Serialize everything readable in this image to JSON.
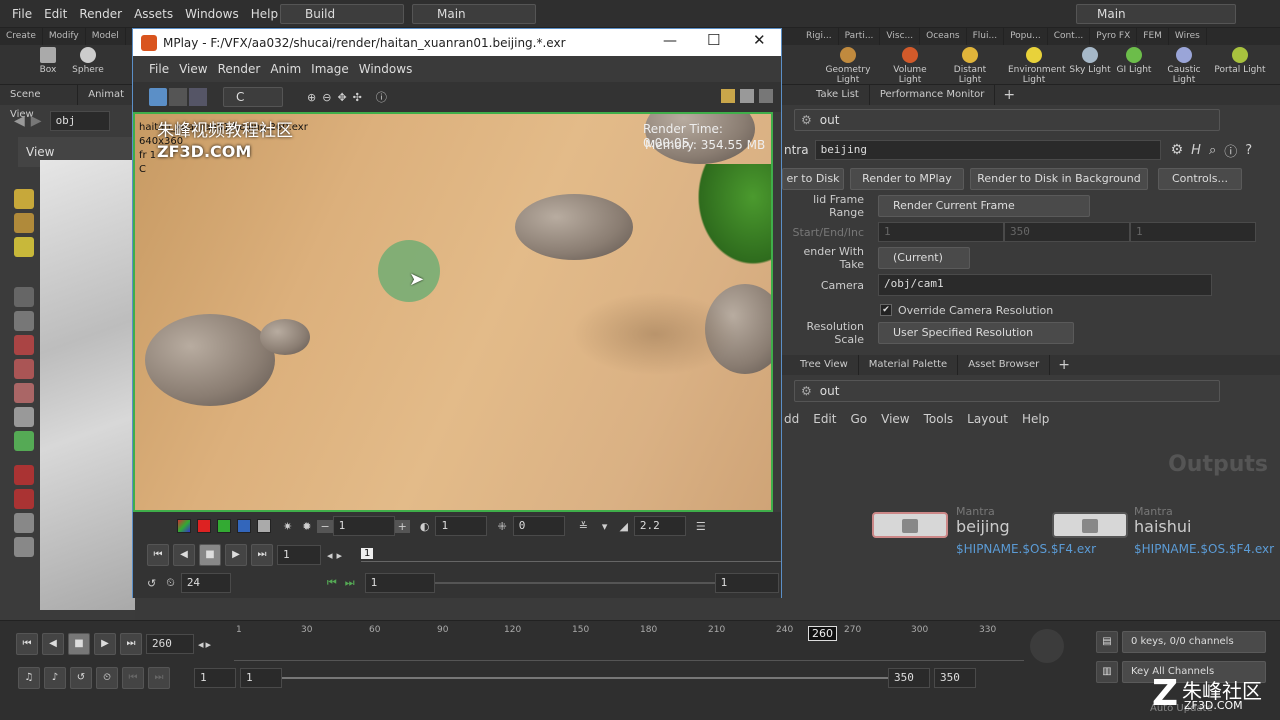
{
  "menubar": {
    "items": [
      "File",
      "Edit",
      "Render",
      "Assets",
      "Windows",
      "Help"
    ],
    "desktop": "Build",
    "context": "Main",
    "main_label": "Main"
  },
  "shelf_tabs_left": [
    "Create",
    "Modify",
    "Model"
  ],
  "shelf_tabs_right": [
    "Rigi...",
    "Parti...",
    "Visc...",
    "Oceans",
    "Flui...",
    "Popu...",
    "Cont...",
    "Pyro FX",
    "FEM",
    "Wires"
  ],
  "shelf_left": [
    "Box",
    "Sphere"
  ],
  "shelf_right": [
    {
      "label": "Geometry Light",
      "color": "#c08a3e"
    },
    {
      "label": "Volume Light",
      "color": "#d25a2a"
    },
    {
      "label": "Distant Light",
      "color": "#e0b43a"
    },
    {
      "label": "Environment Light",
      "color": "#e8d23a"
    },
    {
      "label": "Sky Light",
      "color": "#a6b8c8"
    },
    {
      "label": "GI Light",
      "color": "#6cbd4a"
    },
    {
      "label": "Caustic Light",
      "color": "#9aa5d8"
    },
    {
      "label": "Portal Light",
      "color": "#a8c23e"
    }
  ],
  "left": {
    "tabs": [
      "Scene View",
      "Animat"
    ],
    "path": "obj",
    "view_label": "View"
  },
  "mplay": {
    "title": "MPlay - F:/VFX/aa032/shucai/render/haitan_xuanran01.beijing.*.exr",
    "menu": [
      "File",
      "View",
      "Render",
      "Anim",
      "Image",
      "Windows"
    ],
    "channel": "C",
    "overlay_file": "haitan_xuanran01.beijing.260.exr",
    "overlay_res": "640x360",
    "overlay_frame": "fr 1",
    "overlay_channel": "C",
    "render_time": "Render Time: 0:00:05",
    "memory": "Memory:  354.55 MB",
    "watermark_cn": "朱峰视频教程社区",
    "watermark_en": "ZF3D.COM",
    "ctrl": {
      "frame_step": "1",
      "exposure": "1",
      "offset": "0",
      "gamma": "2.2",
      "cur_frame": "1",
      "frame_marker": "1",
      "fps": "24",
      "range_start": "1",
      "range_end": "1"
    }
  },
  "right": {
    "tabs1": [
      "Take List",
      "Performance Monitor"
    ],
    "path": "out",
    "node_type": "ntra",
    "node_name": "beijing",
    "buttons": [
      "er to Disk",
      "Render to MPlay",
      "Render to Disk in Background",
      "Controls..."
    ],
    "valid_frame_label": "lid Frame Range",
    "valid_frame_value": "Render Current Frame",
    "start_label": "Start/End/Inc",
    "start_vals": [
      "1",
      "350",
      "1"
    ],
    "take_label": "ender With Take",
    "take_value": "(Current)",
    "camera_label": "Camera",
    "camera_value": "/obj/cam1",
    "override_label": "Override Camera Resolution",
    "res_scale_label": "Resolution Scale",
    "res_scale_value": "User Specified Resolution",
    "tabs2": [
      "Tree View",
      "Material Palette",
      "Asset Browser"
    ],
    "path2": "out",
    "net_menu": [
      "dd",
      "Edit",
      "Go",
      "View",
      "Tools",
      "Layout",
      "Help"
    ],
    "outputs_label": "Outputs",
    "nodes": [
      {
        "type": "Mantra",
        "name": "beijing",
        "file": "$HIPNAME.$OS.$F4.exr"
      },
      {
        "type": "Mantra",
        "name": "haishui",
        "file": "$HIPNAME.$OS.$F4.exr"
      }
    ]
  },
  "timeline": {
    "frame": "260",
    "ticks": [
      "1",
      "30",
      "60",
      "90",
      "120",
      "150",
      "180",
      "210",
      "240",
      "270",
      "300",
      "330"
    ],
    "current_marker": "260",
    "start": "1",
    "start2": "1",
    "end": "350",
    "end2": "350",
    "keys": "0 keys, 0/0 channels",
    "key_all": "Key All Channels",
    "auto_update": "Auto Update",
    "watermark": "朱峰社区",
    "watermark_url": "ZF3D.COM"
  }
}
